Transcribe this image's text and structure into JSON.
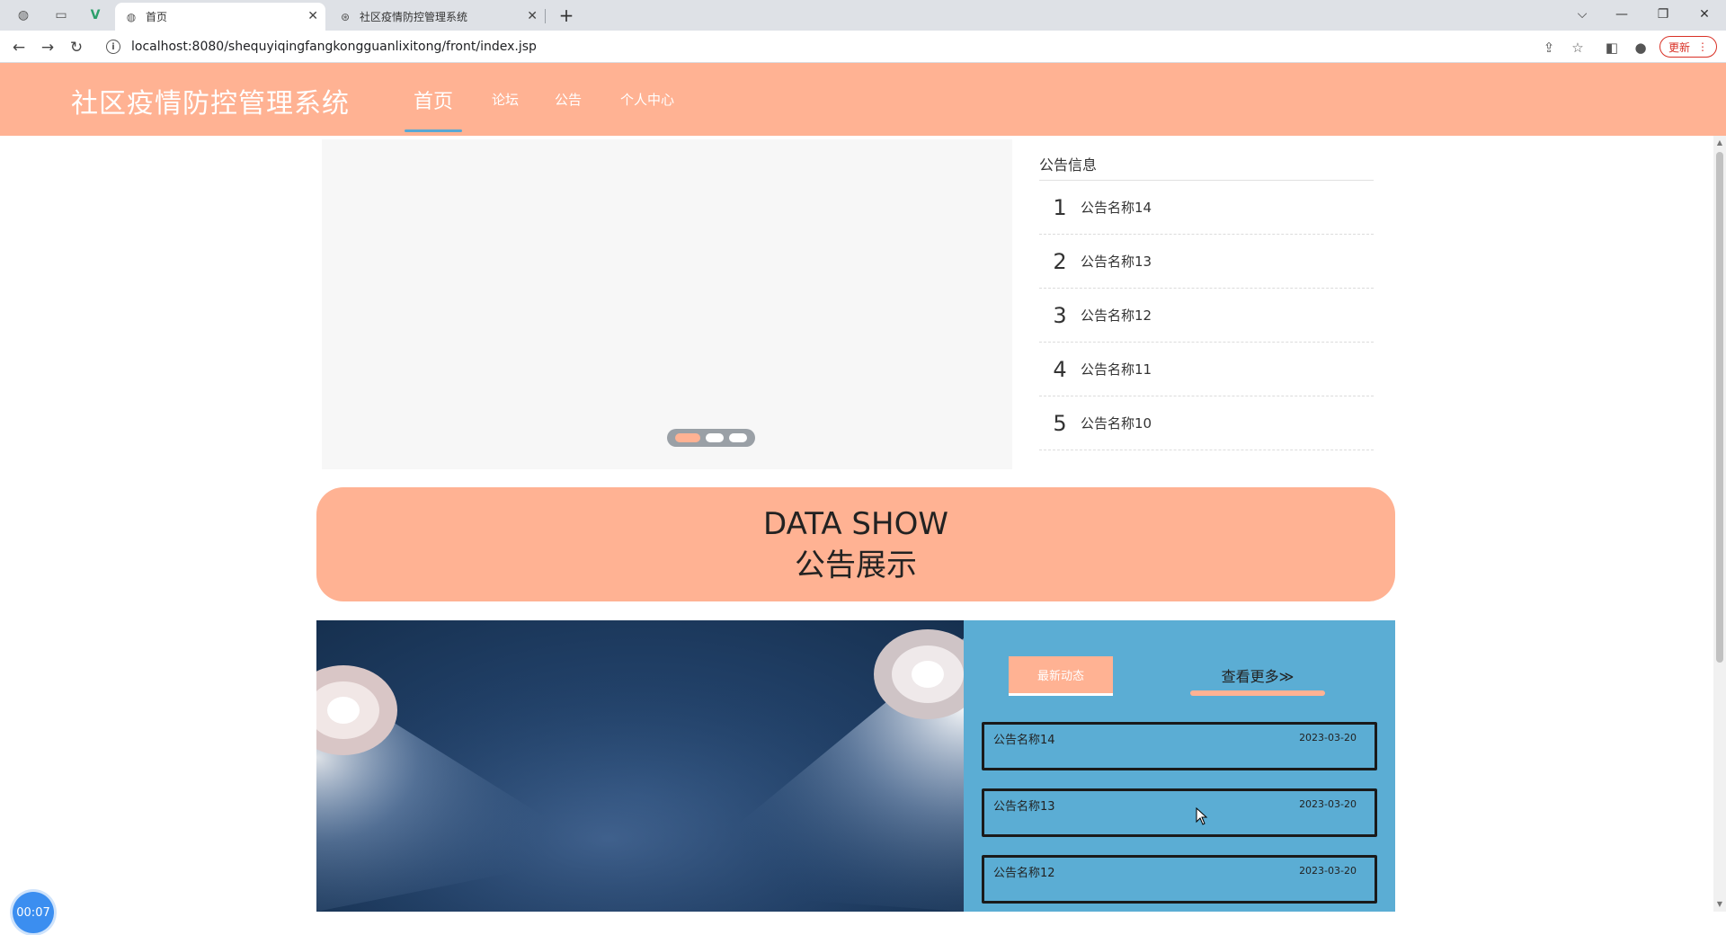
{
  "browser": {
    "tabs": [
      {
        "title": "首页",
        "active": true
      },
      {
        "title": "社区疫情防控管理系统",
        "active": false
      }
    ],
    "new_tab_label": "+",
    "url": "localhost:8080/shequyiqingfangkongguanlixitong/front/index.jsp",
    "update_label": "更新",
    "window_controls": {
      "chevron": "⌵",
      "minimize": "—",
      "restore": "❐",
      "close": "✕"
    },
    "nav": {
      "back": "←",
      "forward": "→",
      "reload": "↻"
    }
  },
  "header": {
    "title": "社区疫情防控管理系统",
    "nav": [
      {
        "label": "首页",
        "active": true
      },
      {
        "label": "论坛",
        "active": false
      },
      {
        "label": "公告",
        "active": false
      },
      {
        "label": "个人中心",
        "active": false
      }
    ]
  },
  "carousel": {
    "slides": 3,
    "active_index": 0
  },
  "notices": {
    "heading": "公告信息",
    "items": [
      {
        "num": "1",
        "name": "公告名称14"
      },
      {
        "num": "2",
        "name": "公告名称13"
      },
      {
        "num": "3",
        "name": "公告名称12"
      },
      {
        "num": "4",
        "name": "公告名称11"
      },
      {
        "num": "5",
        "name": "公告名称10"
      }
    ]
  },
  "banner": {
    "en": "DATA SHOW",
    "cn": "公告展示"
  },
  "feature": {
    "tab_label": "最新动态",
    "more_label": "查看更多≫",
    "news": [
      {
        "title": "公告名称14",
        "date": "2023-03-20"
      },
      {
        "title": "公告名称13",
        "date": "2023-03-20"
      },
      {
        "title": "公告名称12",
        "date": "2023-03-20"
      }
    ]
  },
  "timer": "00:07",
  "colors": {
    "accent": "#ffb293",
    "blue": "#5badd4",
    "nav_underline": "#58a8d4"
  }
}
